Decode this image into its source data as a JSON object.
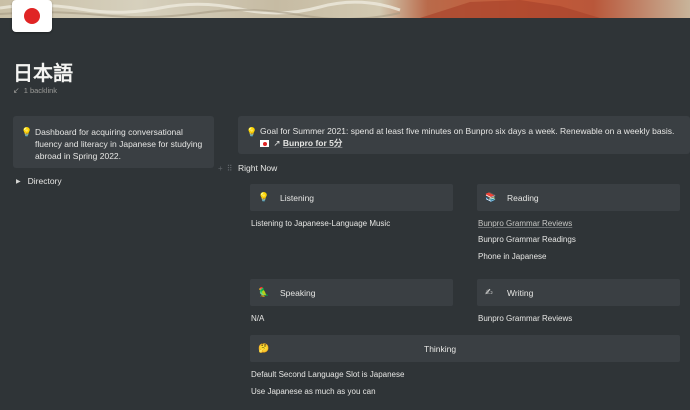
{
  "page": {
    "title": "日本語",
    "backlinks": "1 backlink",
    "icon": "japan-flag-icon"
  },
  "callout_left": {
    "icon": "light-bulb-icon",
    "text": "Dashboard for acquiring conversational fluency and literacy in Japanese for studying abroad in Spring 2022."
  },
  "callout_right": {
    "icon": "light-bulb-icon",
    "text": "Goal for Summer 2021: spend at least five minutes on Bunpro six days a week. Renewable on a weekly basis.",
    "link_prefix": "↗",
    "link_text": "Bunpro for 5分"
  },
  "toggle": {
    "label": "Directory"
  },
  "section": {
    "title": "Right Now"
  },
  "cards": {
    "listening": {
      "icon": "💡",
      "label": "Listening",
      "items": [
        "Listening to Japanese-Language Music"
      ]
    },
    "reading": {
      "icon": "📚",
      "label": "Reading",
      "items": [
        "Bunpro Grammar Reviews",
        "Bunpro Grammar Readings",
        "Phone in Japanese"
      ]
    },
    "speaking": {
      "icon": "🦜",
      "label": "Speaking",
      "items": [
        "N/A"
      ]
    },
    "writing": {
      "icon": "✍",
      "label": "Writing",
      "items": [
        "Bunpro Grammar Reviews"
      ]
    },
    "thinking": {
      "icon": "🤔",
      "label": "Thinking",
      "items": [
        "Default Second Language Slot is Japanese",
        "Use Japanese as much as you can"
      ]
    }
  }
}
